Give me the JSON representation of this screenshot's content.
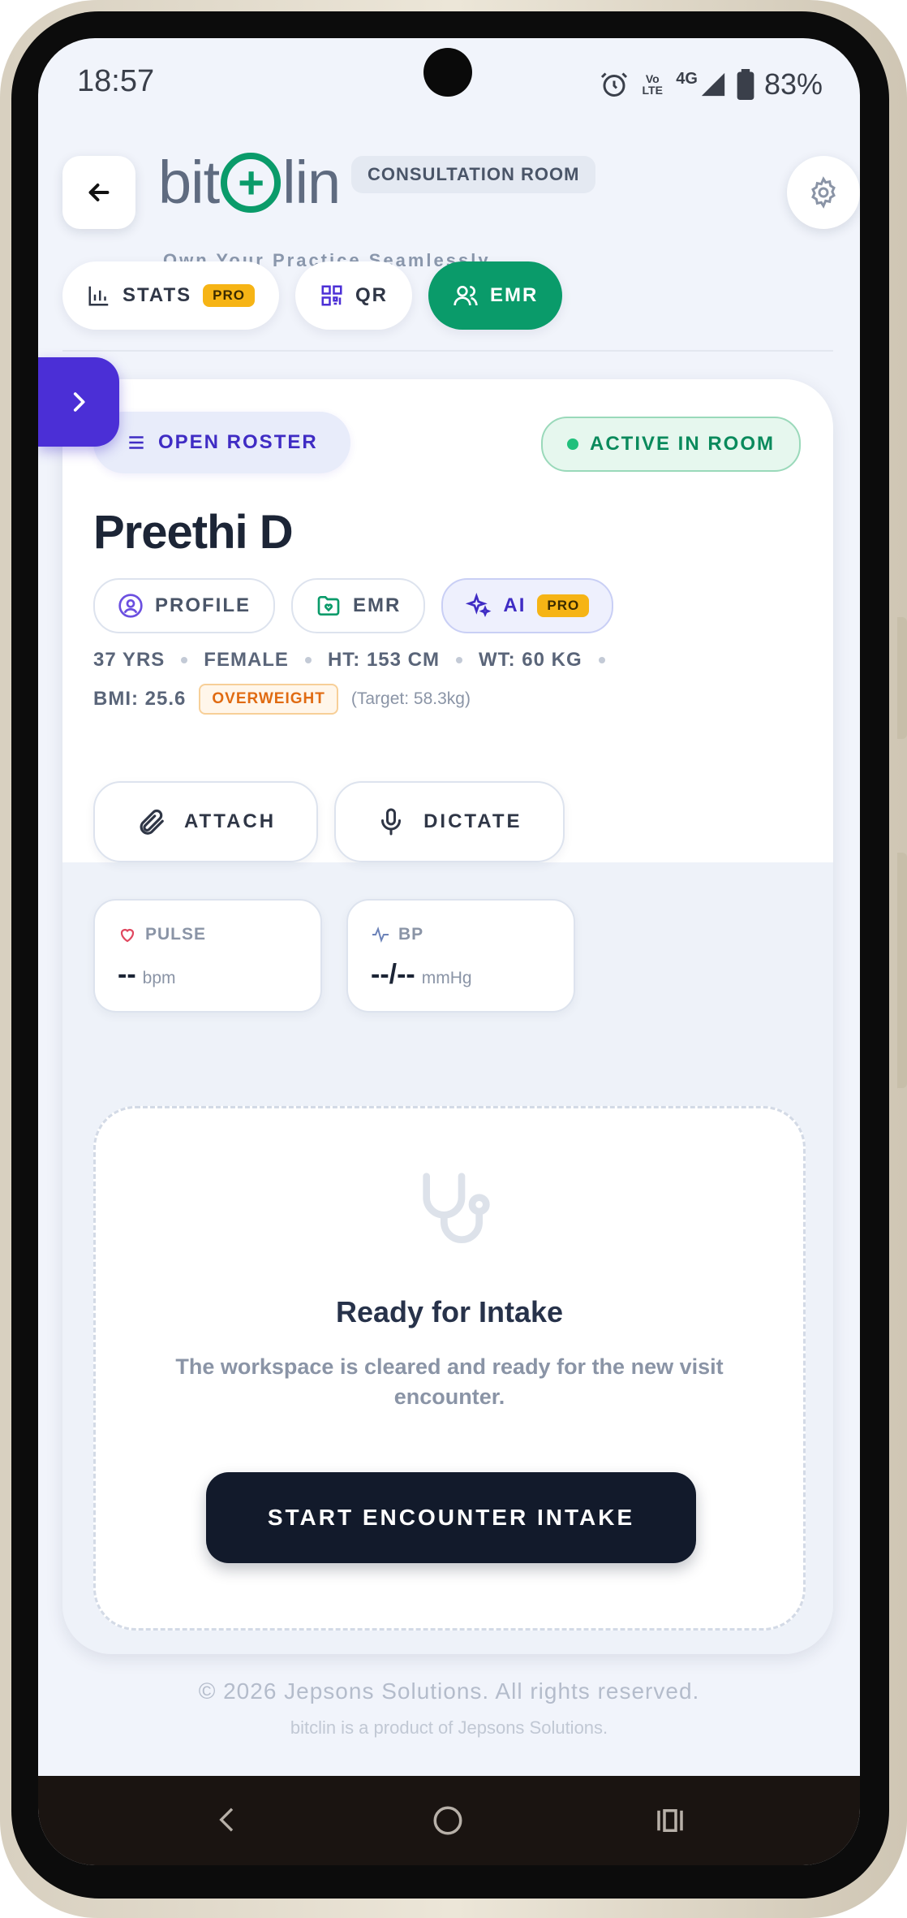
{
  "status_bar": {
    "time": "18:57",
    "network": "4G",
    "volte": "Vo LTE",
    "battery": "83%"
  },
  "header": {
    "brand": {
      "pre": "bit",
      "mid": "+",
      "post": "lin"
    },
    "room_label": "CONSULTATION ROOM",
    "tagline": "Own Your Practice Seamlessly"
  },
  "nav": {
    "stats": "STATS",
    "stats_badge": "PRO",
    "qr": "QR",
    "emr": "EMR"
  },
  "patient": {
    "roster_label": "OPEN ROSTER",
    "status_label": "ACTIVE IN ROOM",
    "name": "Preethi D",
    "chips": {
      "profile": "PROFILE",
      "emr": "EMR",
      "ai": "AI",
      "ai_badge": "PRO"
    },
    "age": "37 YRS",
    "gender": "FEMALE",
    "height": "HT: 153 CM",
    "weight": "WT: 60 KG",
    "bmi": "BMI: 25.6",
    "bmi_category": "OVERWEIGHT",
    "target": "(Target: 58.3kg)",
    "attach_label": "ATTACH",
    "dictate_label": "DICTATE"
  },
  "vitals": {
    "pulse": {
      "label": "PULSE",
      "value": "--",
      "unit": "bpm"
    },
    "bp": {
      "label": "BP",
      "value": "--/--",
      "unit": "mmHg"
    }
  },
  "intake": {
    "title": "Ready for Intake",
    "description": "The workspace is cleared and ready for the new visit encounter.",
    "button": "START ENCOUNTER INTAKE"
  },
  "footer": {
    "copyright": "© 2026 Jepsons Solutions. All rights reserved.",
    "product": "bitclin is a product of Jepsons Solutions."
  },
  "colors": {
    "brand_green": "#0a9b6a",
    "accent_indigo": "#4b2fd6",
    "pro_gold": "#f6b415",
    "dark_button": "#121a2b"
  }
}
